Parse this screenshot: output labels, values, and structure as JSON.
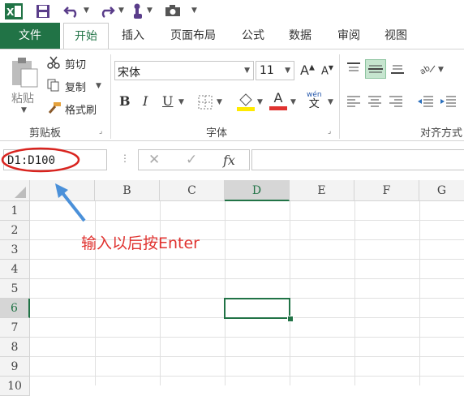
{
  "quick_access": {
    "app_icon": "excel-icon",
    "icons": [
      "save-icon",
      "undo-icon",
      "redo-icon",
      "touch-mode-icon",
      "camera-icon",
      "customize-icon"
    ]
  },
  "tabs": [
    "文件",
    "开始",
    "插入",
    "页面布局",
    "公式",
    "数据",
    "审阅",
    "视图"
  ],
  "clipboard": {
    "paste": "粘贴",
    "cut": "剪切",
    "copy": "复制",
    "format_painter": "格式刷",
    "group": "剪贴板"
  },
  "font": {
    "name": "宋体",
    "size": "11",
    "group": "字体",
    "bold": "B",
    "italic": "I",
    "underline": "U",
    "font_color": "A",
    "wen": "wén",
    "wen_char": "文"
  },
  "alignment": {
    "group": "对齐方式"
  },
  "formula_bar": {
    "name_box": "D1:D100",
    "fx": "fx"
  },
  "columns": [
    "B",
    "C",
    "D",
    "E",
    "F",
    "G"
  ],
  "rows": [
    "1",
    "2",
    "3",
    "4",
    "5",
    "6",
    "7",
    "8",
    "9",
    "10"
  ],
  "annotation": "输入以后按Enter",
  "colors": {
    "excel_green": "#217346",
    "annotation_red": "#e0322f",
    "arrow_blue": "#4a90d9"
  }
}
